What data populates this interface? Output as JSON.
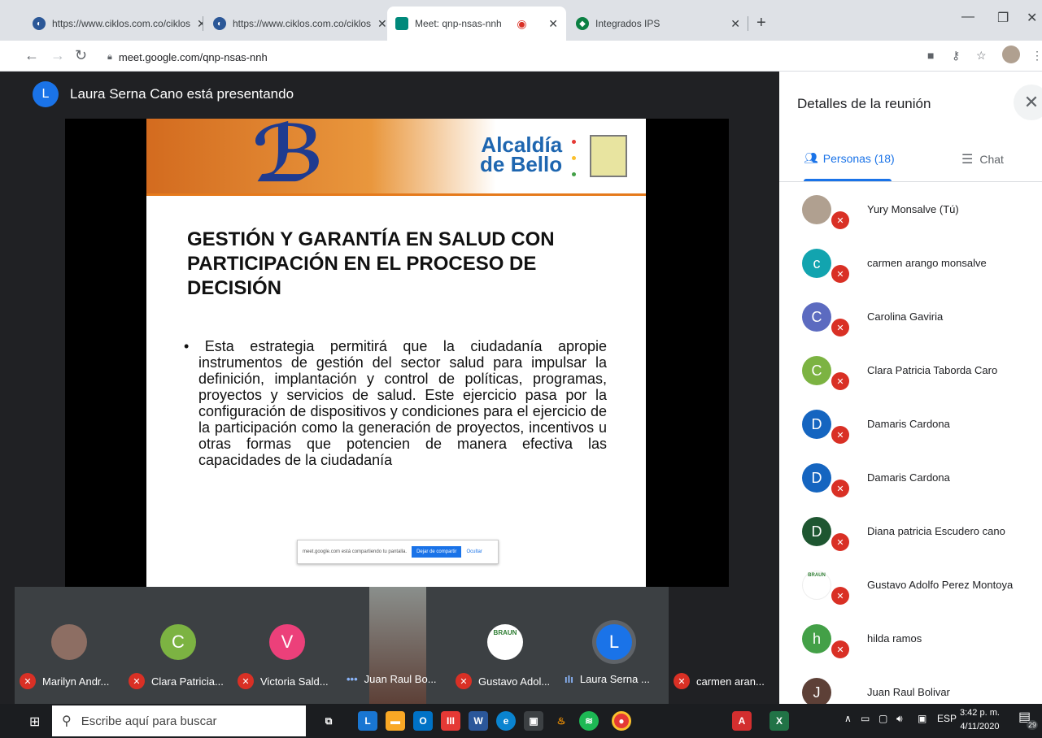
{
  "browser": {
    "tabs": [
      {
        "title": "https://www.ciklos.com.co/ciklos",
        "icon": "ciklos-favicon"
      },
      {
        "title": "https://www.ciklos.com.co/ciklos",
        "icon": "ciklos-favicon"
      },
      {
        "title": "Meet: qnp-nsas-nnh",
        "icon": "meet-favicon"
      },
      {
        "title": "Integrados IPS",
        "icon": "integrados-favicon"
      }
    ],
    "url": "meet.google.com/qnp-nsas-nnh"
  },
  "meeting": {
    "presenter_initial": "L",
    "presenter_text": "Laura Serna Cano está presentando",
    "slide": {
      "brand_line1": "Alcaldía",
      "brand_line2": "de Bello",
      "title_line1": "GESTIÓN Y GARANTÍA EN SALUD CON",
      "title_line2": "PARTICIPACIÓN EN EL PROCESO DE DECISIÓN",
      "body": "• Esta estrategia permitirá que la ciudadanía apropie instrumentos de gestión del sector salud para impulsar la definición, implantación y control de políticas, programas, proyectos y servicios de salud. Este ejercicio pasa por la configuración de dispositivos y condiciones para el ejercicio de la participación como la generación de proyectos, incentivos u otras formas que potencien de manera efectiva las capacidades de la ciudadanía"
    },
    "share_bar": {
      "message": "meet.google.com está compartiendo tu pantalla.",
      "stop_label": "Dejar de compartir",
      "hide_label": "Ocultar"
    },
    "tiles": [
      {
        "name": "Marilyn Andr...",
        "avatar": "",
        "color": "#8d6e63",
        "mic": "muted"
      },
      {
        "name": "Clara Patricia...",
        "avatar": "C",
        "color": "#7cb342",
        "mic": "muted"
      },
      {
        "name": "Victoria Sald...",
        "avatar": "V",
        "color": "#ec407a",
        "mic": "muted"
      },
      {
        "name": "Juan Raul Bo...",
        "avatar": "",
        "color": "#5d4037",
        "mic": "more"
      },
      {
        "name": "Gustavo Adol...",
        "avatar": "BRAUN",
        "color": "#ffffff",
        "mic": "muted"
      },
      {
        "name": "Laura Serna ...",
        "avatar": "L",
        "color": "#1a73e8",
        "mic": "speaking"
      },
      {
        "name": "carmen aran...",
        "avatar": "",
        "color": "#3c4043",
        "mic": "muted"
      }
    ]
  },
  "panel": {
    "title": "Detalles de la reunión",
    "people_tab": "Personas (18)",
    "chat_tab": "Chat",
    "people": [
      {
        "name": "Yury Monsalve (Tú)",
        "initial": "",
        "color": "#b0a090"
      },
      {
        "name": "carmen arango monsalve",
        "initial": "c",
        "color": "#12a4af"
      },
      {
        "name": "Carolina Gaviria",
        "initial": "C",
        "color": "#5c6bc0"
      },
      {
        "name": "Clara Patricia Taborda Caro",
        "initial": "C",
        "color": "#7cb342"
      },
      {
        "name": "Damaris Cardona",
        "initial": "D",
        "color": "#1565c0"
      },
      {
        "name": "Damaris Cardona",
        "initial": "D",
        "color": "#1565c0"
      },
      {
        "name": "Diana patricia Escudero cano",
        "initial": "D",
        "color": "#1e5631"
      },
      {
        "name": "Gustavo Adolfo Perez Montoya",
        "initial": "BRAUN",
        "color": "#ffffff"
      },
      {
        "name": "hilda ramos",
        "initial": "h",
        "color": "#43a047"
      },
      {
        "name": "Juan Raul Bolivar",
        "initial": "J",
        "color": "#5d4037"
      }
    ]
  },
  "taskbar": {
    "search_placeholder": "Escribe aquí para buscar",
    "lang": "ESP",
    "time": "3:42 p. m.",
    "date": "4/11/2020",
    "notif_count": "29"
  }
}
